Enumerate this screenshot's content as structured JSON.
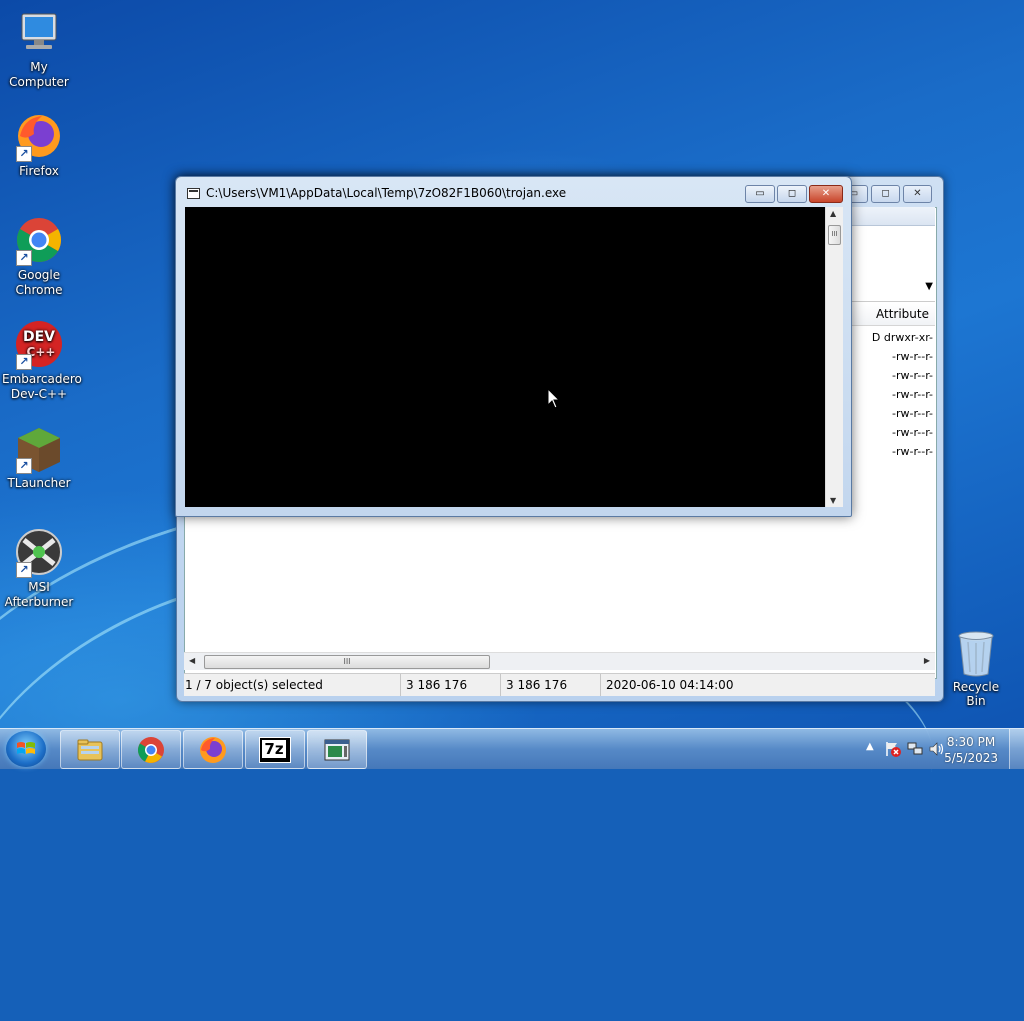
{
  "desktop": {
    "icons": [
      {
        "label": "My Computer",
        "icon": "computer-icon"
      },
      {
        "label": "Firefox",
        "icon": "firefox-icon"
      },
      {
        "label": "Google Chrome",
        "icon": "chrome-icon"
      },
      {
        "label": "Embarcadero Dev-C++",
        "icon": "devcpp-icon"
      },
      {
        "label": "TLauncher",
        "icon": "tlauncher-icon"
      },
      {
        "label": "MSI Afterburner",
        "icon": "afterburner-icon"
      }
    ],
    "recycle_bin": {
      "label": "Recycle Bin",
      "icon": "recycle-bin-icon"
    },
    "devcpp_logo_text": "DEV C++"
  },
  "console_window": {
    "title": "C:\\Users\\VM1\\AppData\\Local\\Temp\\7zO82F1B060\\trojan.exe",
    "buttons": {
      "minimize": "▭",
      "maximize": "◻",
      "close": "✕"
    }
  },
  "explorer_window": {
    "column_header": "Attribute",
    "attributes": [
      "D drwxr-xr-",
      "-rw-r--r-",
      "-rw-r--r-",
      "-rw-r--r-",
      "-rw-r--r-",
      "-rw-r--r-",
      "-rw-r--r-"
    ],
    "status": {
      "selection": "1 / 7 object(s) selected",
      "size": "3 186 176",
      "packed_size": "3 186 176",
      "modified": "2020-06-10 04:14:00"
    },
    "thumb_grip": "III"
  },
  "taskbar": {
    "buttons": [
      {
        "name": "explorer",
        "icon": "folder-icon"
      },
      {
        "name": "chrome",
        "icon": "chrome-icon"
      },
      {
        "name": "firefox",
        "icon": "firefox-icon"
      },
      {
        "name": "7zip",
        "icon": "7zip-icon",
        "text": "7z"
      },
      {
        "name": "console",
        "icon": "console-icon"
      }
    ],
    "clock": {
      "time": "8:30 PM",
      "date": "5/5/2023"
    },
    "tray_icons": [
      "show-hidden-icons-icon",
      "action-center-icon",
      "network-icon",
      "volume-icon"
    ]
  }
}
